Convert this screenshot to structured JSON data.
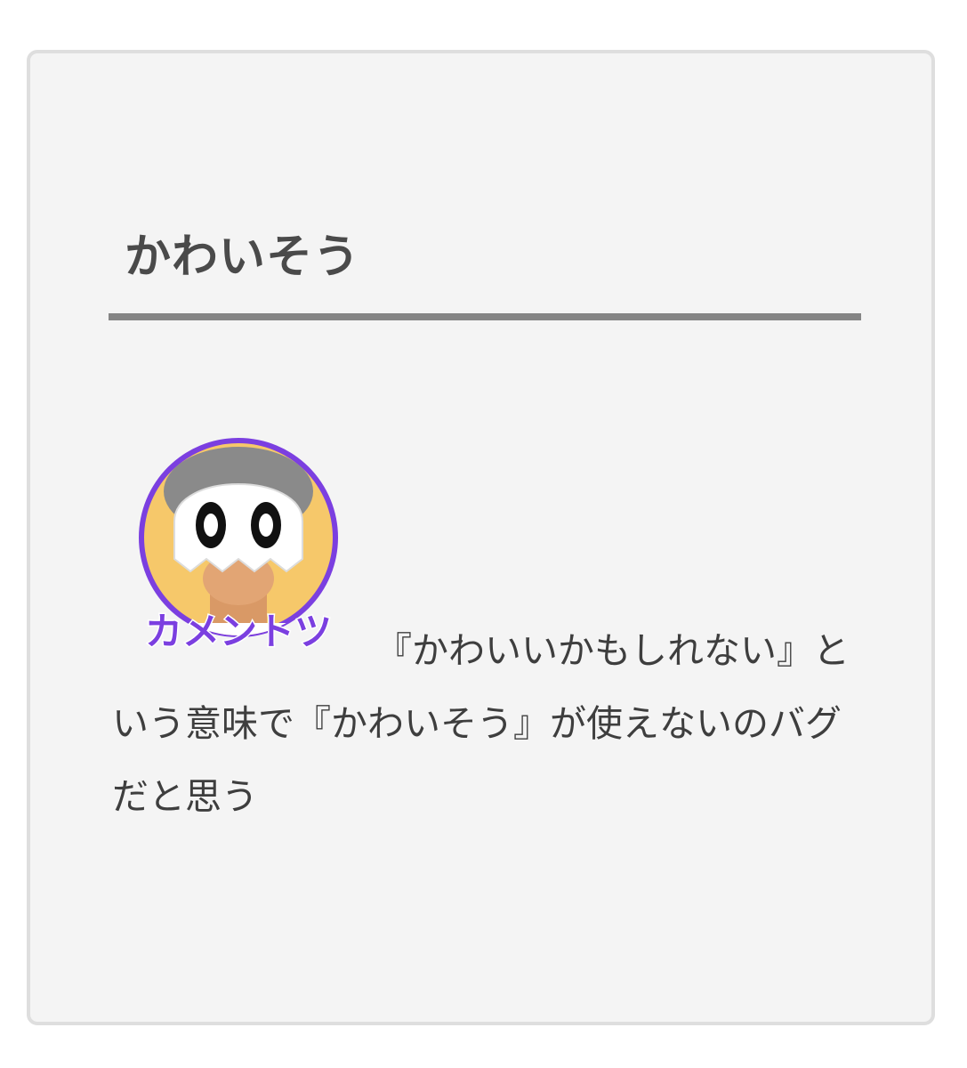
{
  "card": {
    "title": "かわいそう",
    "avatar": {
      "badge_text": "カメントツ",
      "ring_color": "#7b3fe0",
      "background_color": "#f6c86a"
    },
    "comment": "『かわいいかもしれない』という意味で『かわいそう』が使えないのバグだと思う"
  }
}
